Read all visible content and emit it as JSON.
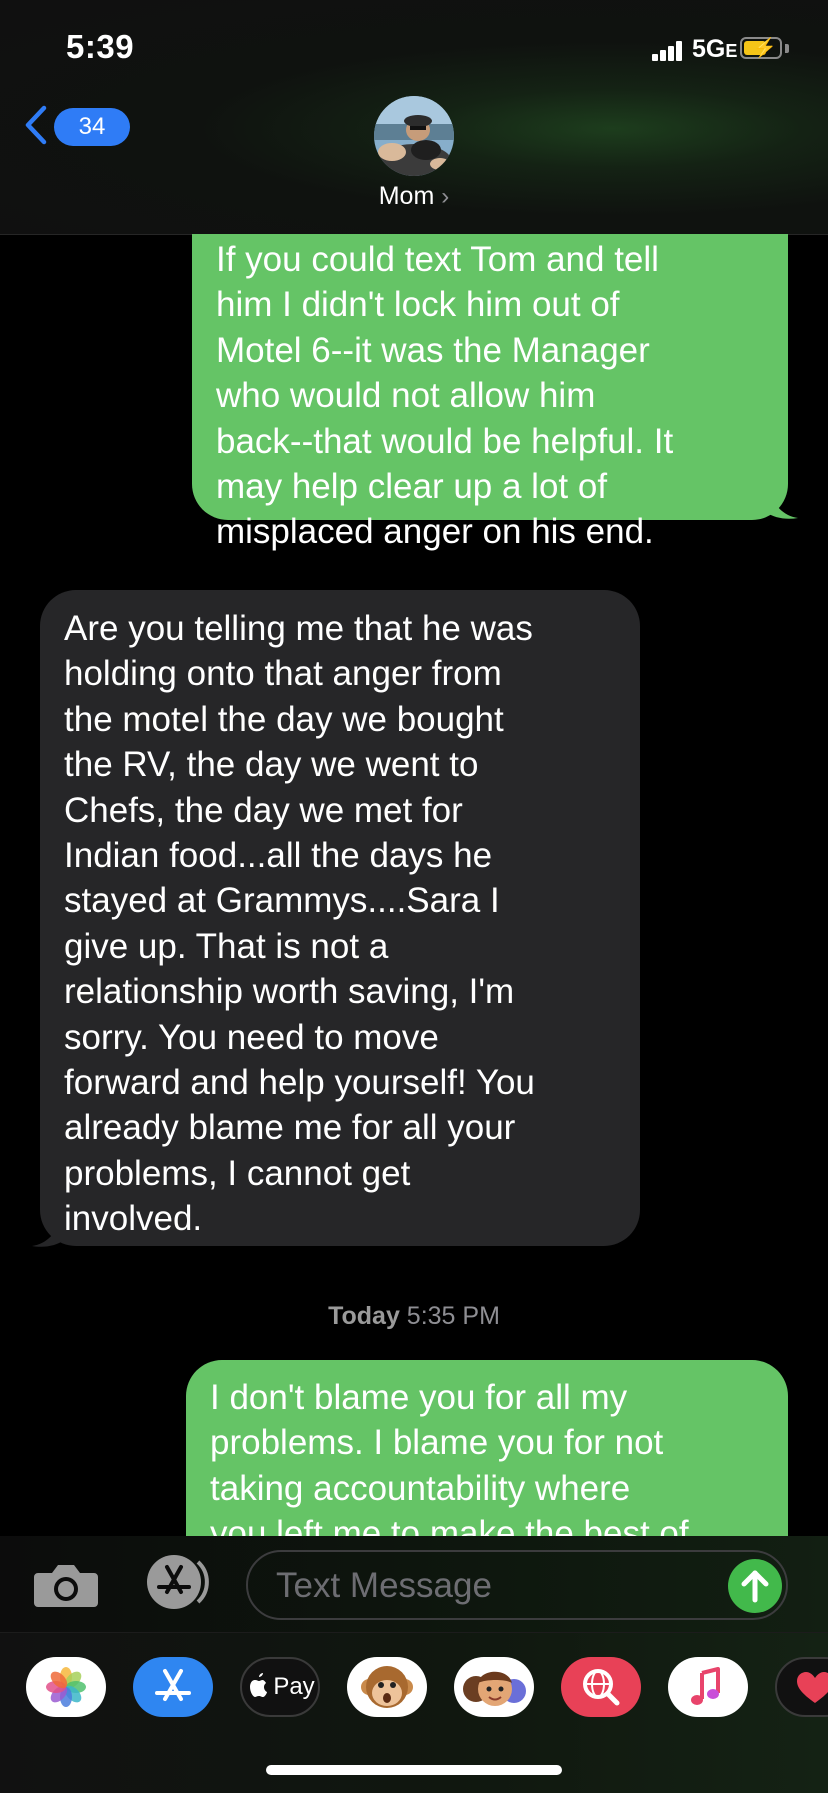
{
  "status_bar": {
    "time": "5:39",
    "network": "5G",
    "network_suffix": "E"
  },
  "header": {
    "back_count": "34",
    "contact_name": "Mom",
    "contact_chevron": "›"
  },
  "messages": [
    {
      "direction": "sent",
      "lines": [
        "If you could text Tom and tell",
        "him I didn't lock him out of",
        "Motel 6--it was the Manager",
        "who would not allow him",
        "back--that would be helpful. It",
        "may help clear up a lot of",
        "misplaced anger on his end."
      ]
    },
    {
      "direction": "received",
      "lines": [
        "Are you telling me that he was",
        "holding onto that anger from",
        "the motel the day we bought",
        "the RV, the day we went to",
        "Chefs, the day we met for",
        "Indian food...all the days he",
        "stayed at Grammys....Sara I",
        "give up. That is not a",
        "relationship worth saving, I'm",
        "sorry. You need to move",
        "forward and help yourself! You",
        "already blame me for all your",
        "problems, I cannot get",
        "involved."
      ]
    },
    {
      "direction": "sent",
      "lines": [
        "I don't blame you for all my",
        "problems. I blame you for not",
        "taking accountability where",
        "you left me to make the best of"
      ]
    }
  ],
  "timestamp": {
    "day": "Today",
    "time": "5:35 PM"
  },
  "input_bar": {
    "placeholder": "Text Message"
  },
  "app_drawer": {
    "apple_pay_label": "Pay",
    "icons": [
      "photos-icon",
      "app-store-icon",
      "apple-pay-icon",
      "animoji-icon",
      "memoji-icon",
      "web-search-icon",
      "music-icon",
      "digital-touch-icon"
    ]
  },
  "colors": {
    "sent_bubble": "#65c466",
    "received_bubble": "#262628",
    "accent_blue": "#2f7cf6",
    "send_button": "#42b94b",
    "battery_charging": "#f5c518"
  }
}
